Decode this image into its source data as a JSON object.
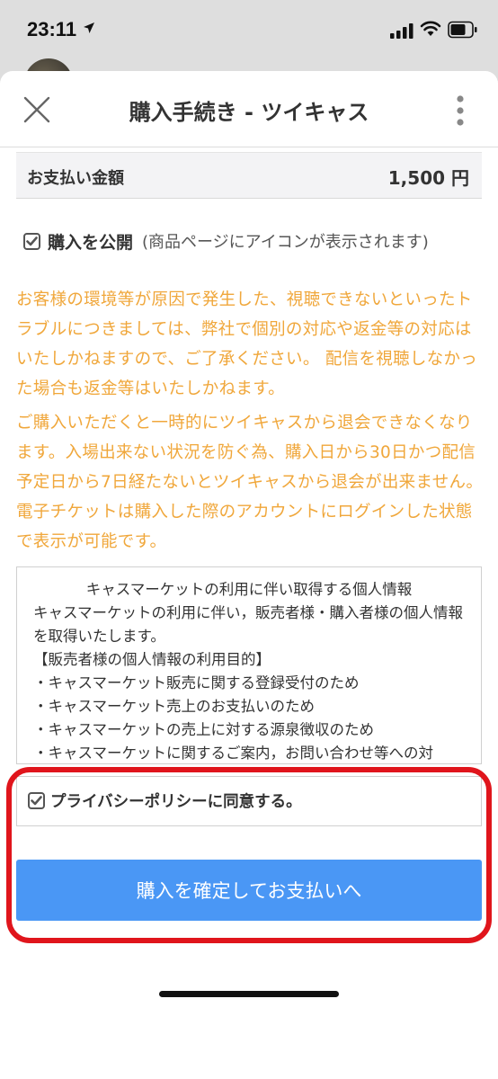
{
  "status_bar": {
    "time": "23:11",
    "icons": [
      "location-arrow-icon",
      "signal-icon",
      "wifi-icon",
      "battery-icon"
    ]
  },
  "header": {
    "title": "購入手続き - ツイキャス",
    "close_icon": "close-icon",
    "more_icon": "more-vertical-icon"
  },
  "payment": {
    "label": "お支払い金額",
    "amount": "1,500 円"
  },
  "publish": {
    "checked": true,
    "label": "購入を公開",
    "note": "(商品ページにアイコンが表示されます)"
  },
  "notices": [
    "お客様の環境等が原因で発生した、視聴できないといったトラブルにつきましては、弊社で個別の対応や返金等の対応はいたしかねますので、ご了承ください。 配信を視聴しなかった場合も返金等はいたしかねます。",
    "ご購入いただくと一時的にツイキャスから退会できなくなります。入場出来ない状況を防ぐ為、購入日から30日かつ配信予定日から7日経たないとツイキャスから退会が出来ません。 電子チケットは購入した際のアカウントにログインした状態で表示が可能です。"
  ],
  "privacy_policy": {
    "title": "キャスマーケットの利用に伴い取得する個人情報",
    "lines": [
      "キャスマーケットの利用に伴い，販売者様・購入者様の個人情報を取得いたします。",
      "【販売者様の個人情報の利用目的】",
      "・キャスマーケット販売に関する登録受付のため",
      "・キャスマーケット売上のお支払いのため",
      "・キャスマーケットの売上に対する源泉徴収のため",
      "・キャスマーケットに関するご案内，お問い合わせ等への対"
    ]
  },
  "agree": {
    "checked": true,
    "label": "プライバシーポリシーに同意する。"
  },
  "confirm_button": {
    "label": "購入を確定してお支払いへ"
  },
  "colors": {
    "notice_text": "#f0a73b",
    "button_blue": "#4a97f5",
    "highlight_red": "#e0151c"
  }
}
